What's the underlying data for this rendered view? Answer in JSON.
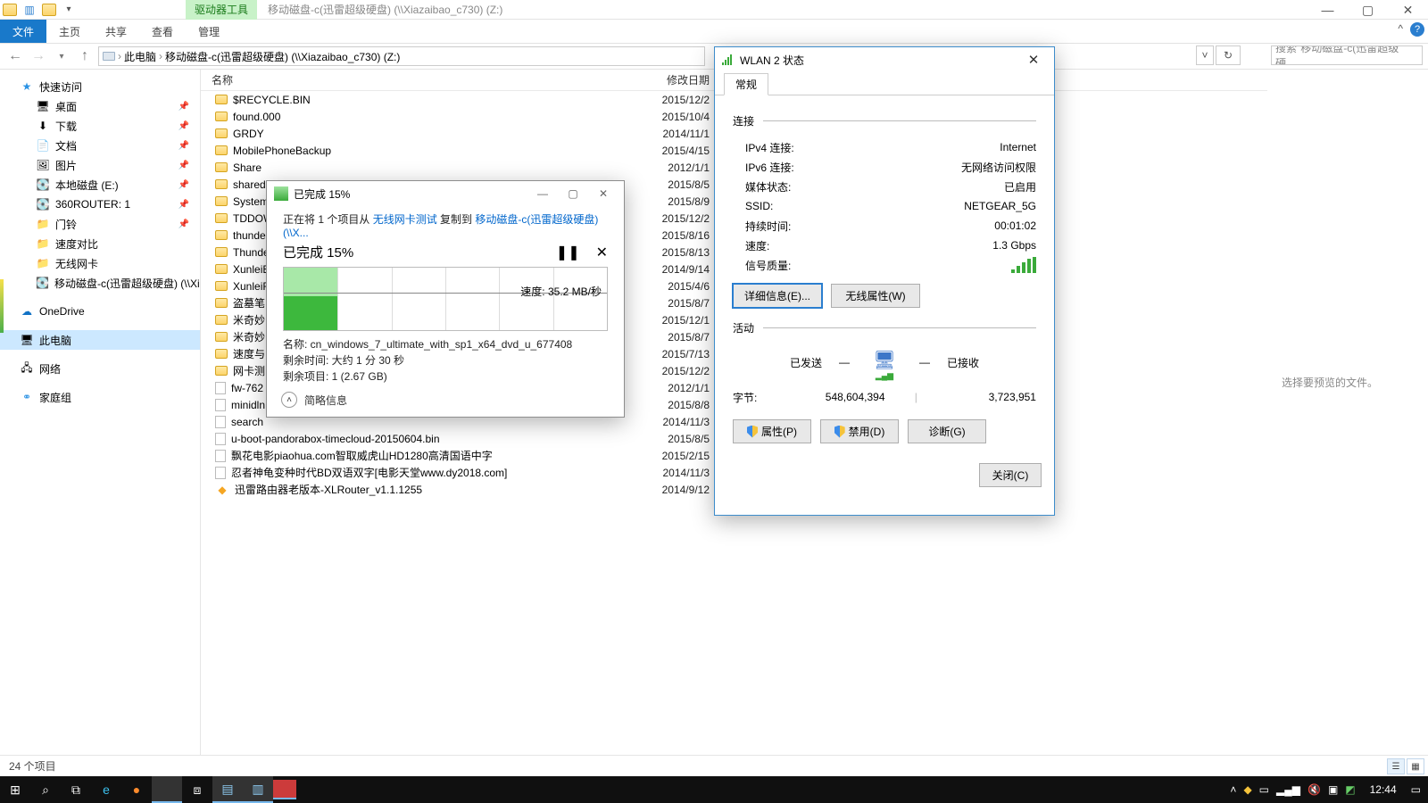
{
  "window": {
    "drive_tool_tab": "驱动器工具",
    "title": "移动磁盘-c(迅雷超级硬盘) (\\\\Xiazaibao_c730) (Z:)",
    "minimize": "—",
    "maximize": "▢",
    "close": "✕"
  },
  "ribbon": {
    "file": "文件",
    "home": "主页",
    "share": "共享",
    "view": "查看",
    "manage": "管理",
    "chevron": "^",
    "help": "?"
  },
  "addr": {
    "this_pc": "此电脑",
    "drive": "移动磁盘-c(迅雷超级硬盘) (\\\\Xiazaibao_c730) (Z:)",
    "search_placeholder": "搜索\"移动磁盘-c(迅雷超级硬...",
    "sep": "›"
  },
  "sidebar": {
    "quick_access": "快速访问",
    "items": [
      {
        "label": "桌面",
        "pin": true
      },
      {
        "label": "下载",
        "pin": true
      },
      {
        "label": "文档",
        "pin": true
      },
      {
        "label": "图片",
        "pin": true
      },
      {
        "label": "本地磁盘 (E:)",
        "pin": true
      },
      {
        "label": "360ROUTER: 1",
        "pin": true
      },
      {
        "label": "门铃",
        "pin": true
      },
      {
        "label": "速度对比",
        "pin": false
      },
      {
        "label": "无线网卡",
        "pin": false
      },
      {
        "label": "移动磁盘-c(迅雷超级硬盘) (\\\\Xiaza",
        "pin": false
      }
    ],
    "onedrive": "OneDrive",
    "thispc": "此电脑",
    "network": "网络",
    "homegroup": "家庭组"
  },
  "columns": {
    "name": "名称",
    "date": "修改日期"
  },
  "files": [
    {
      "t": "f",
      "n": "$RECYCLE.BIN",
      "d": "2015/12/2"
    },
    {
      "t": "f",
      "n": "found.000",
      "d": "2015/10/4"
    },
    {
      "t": "f",
      "n": "GRDY",
      "d": "2014/11/1"
    },
    {
      "t": "f",
      "n": "MobilePhoneBackup",
      "d": "2015/4/15"
    },
    {
      "t": "f",
      "n": "Share",
      "d": "2012/1/1"
    },
    {
      "t": "f",
      "n": "shared",
      "d": "2015/8/5"
    },
    {
      "t": "f",
      "n": "System",
      "d": "2015/8/9"
    },
    {
      "t": "f",
      "n": "TDDOW",
      "d": "2015/12/2"
    },
    {
      "t": "f",
      "n": "thunde",
      "d": "2015/8/16"
    },
    {
      "t": "f",
      "n": "Thunde",
      "d": "2015/8/13"
    },
    {
      "t": "f",
      "n": "XunleiB",
      "d": "2014/9/14"
    },
    {
      "t": "f",
      "n": "XunleiF",
      "d": "2015/4/6"
    },
    {
      "t": "f",
      "n": "盗墓笔",
      "d": "2015/8/7"
    },
    {
      "t": "f",
      "n": "米奇妙",
      "d": "2015/12/1"
    },
    {
      "t": "f",
      "n": "米奇妙",
      "d": "2015/8/7"
    },
    {
      "t": "f",
      "n": "速度与",
      "d": "2015/7/13"
    },
    {
      "t": "f",
      "n": "网卡测",
      "d": "2015/12/2"
    },
    {
      "t": "d",
      "n": "fw-762",
      "d": "2012/1/1"
    },
    {
      "t": "d",
      "n": "minidln",
      "d": "2015/8/8"
    },
    {
      "t": "d",
      "n": "search",
      "d": "2014/11/3"
    },
    {
      "t": "d",
      "n": "u-boot-pandorabox-timecloud-20150604.bin",
      "d": "2015/8/5"
    },
    {
      "t": "d",
      "n": "飘花电影piaohua.com智取威虎山HD1280高清国语中字",
      "d": "2015/2/15"
    },
    {
      "t": "d",
      "n": "忍者神龟变种时代BD双语双字[电影天堂www.dy2018.com]",
      "d": "2014/11/3"
    },
    {
      "t": "e",
      "n": "迅雷路由器老版本-XLRouter_v1.1.1255",
      "d": "2014/9/12"
    }
  ],
  "preview": "选择要预览的文件。",
  "status": "24 个项目",
  "copy": {
    "title": "已完成 15%",
    "line1_a": "正在将 1 个项目从 ",
    "line1_b": "无线网卡测试",
    "line1_c": " 复制到 ",
    "line1_d": "移动磁盘-c(迅雷超级硬盘) (\\\\X...",
    "percent": "已完成 15%",
    "pause": "❚❚",
    "cancel": "✕",
    "speed": "速度: 35.2 MB/秒",
    "name_lbl": "名称: ",
    "name_val": "cn_windows_7_ultimate_with_sp1_x64_dvd_u_677408",
    "rem_lbl": "剩余时间: ",
    "rem_val": "大约 1 分 30 秒",
    "items_lbl": "剩余项目: ",
    "items_val": "1 (2.67 GB)",
    "collapse": "简略信息",
    "min": "—",
    "max": "▢",
    "close": "✕"
  },
  "wlan": {
    "title": "WLAN 2 状态",
    "tab": "常规",
    "grp_conn": "连接",
    "ipv4_k": "IPv4 连接:",
    "ipv4_v": "Internet",
    "ipv6_k": "IPv6 连接:",
    "ipv6_v": "无网络访问权限",
    "media_k": "媒体状态:",
    "media_v": "已启用",
    "ssid_k": "SSID:",
    "ssid_v": "NETGEAR_5G",
    "dur_k": "持续时间:",
    "dur_v": "00:01:02",
    "speed_k": "速度:",
    "speed_v": "1.3 Gbps",
    "sig_k": "信号质量:",
    "btn_details": "详细信息(E)...",
    "btn_wprops": "无线属性(W)",
    "grp_act": "活动",
    "sent": "已发送",
    "recv": "已接收",
    "dash": "—",
    "bytes_k": "字节:",
    "bytes_sent": "548,604,394",
    "bytes_recv": "3,723,951",
    "btn_props": "属性(P)",
    "btn_disable": "禁用(D)",
    "btn_diag": "诊断(G)",
    "btn_close": "关闭(C)",
    "close": "✕"
  },
  "taskbar": {
    "clock": "12:44"
  }
}
